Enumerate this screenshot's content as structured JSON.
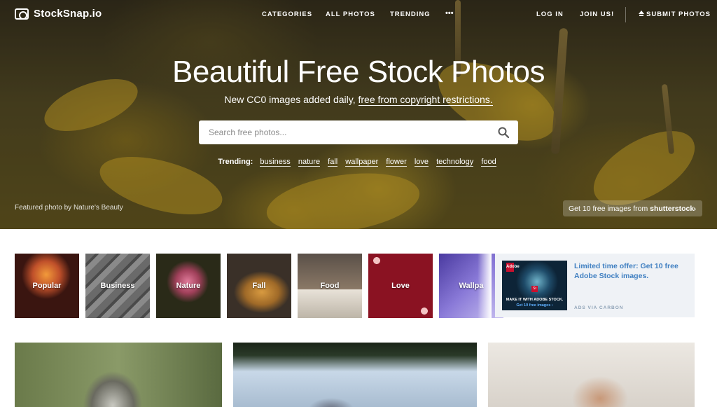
{
  "brand": {
    "name": "StockSnap.io"
  },
  "nav": {
    "categories": "CATEGORIES",
    "all_photos": "ALL PHOTOS",
    "trending": "TRENDING",
    "more": "•••",
    "login": "LOG IN",
    "join": "JOIN US!",
    "submit": "SUBMIT PHOTOS"
  },
  "hero": {
    "title": "Beautiful Free Stock Photos",
    "subtitle_prefix": "New CC0 images added daily,",
    "subtitle_link": "free from copyright restrictions.",
    "credit_prefix": "Featured photo by",
    "credit_author": "Nature's Beauty",
    "promo_text": "Get 10 free images from",
    "promo_brand": "shutterstock",
    "promo_chevron": "›"
  },
  "search": {
    "placeholder": "Search free photos...",
    "value": ""
  },
  "trending": {
    "label": "Trending:",
    "tags": [
      "business",
      "nature",
      "fall",
      "wallpaper",
      "flower",
      "love",
      "technology",
      "food"
    ]
  },
  "categories": [
    "Popular",
    "Business",
    "Nature",
    "Fall",
    "Food",
    "Love",
    "Wallpa"
  ],
  "ad": {
    "logo": "Adobe",
    "badge": "St",
    "caption_1": "MAKE IT WITH ADOBE STOCK.",
    "caption_2": "Get 10 free images ›",
    "text": "Limited time offer: Get 10 free Adobe Stock images.",
    "via": "ADS VIA CARBON"
  },
  "colors": {
    "accent": "#3f7fc1",
    "ad_bg": "#eff2f6"
  }
}
